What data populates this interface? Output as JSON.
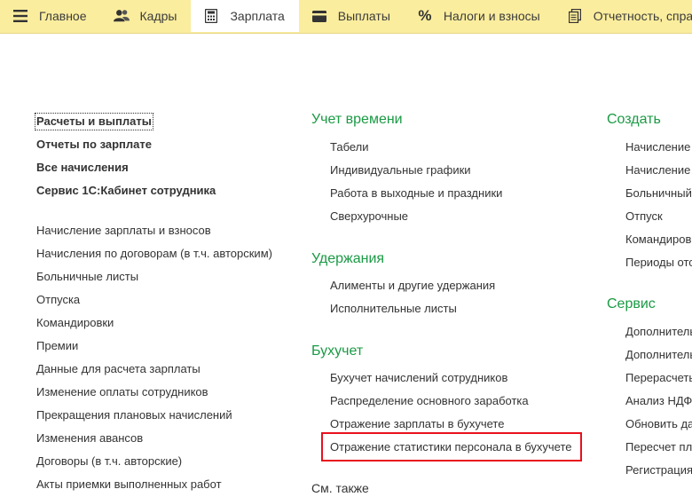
{
  "topbar": {
    "tabs": [
      {
        "label": "Главное",
        "icon": "menu-lines-icon",
        "active": false
      },
      {
        "label": "Кадры",
        "icon": "people-icon",
        "active": false
      },
      {
        "label": "Зарплата",
        "icon": "calculator-icon",
        "active": true
      },
      {
        "label": "Выплаты",
        "icon": "wallet-icon",
        "active": false
      },
      {
        "label": "Налоги и взносы",
        "icon": "percent-icon",
        "active": false
      },
      {
        "label": "Отчетность, справки",
        "icon": "documents-icon",
        "active": false
      }
    ]
  },
  "left_column": {
    "bold_items": [
      "Расчеты и выплаты",
      "Отчеты по зарплате",
      "Все начисления",
      "Сервис 1С:Кабинет сотрудника"
    ],
    "items": [
      "Начисление зарплаты и взносов",
      "Начисления по договорам (в т.ч. авторским)",
      "Больничные листы",
      "Отпуска",
      "Командировки",
      "Премии",
      "Данные для расчета зарплаты",
      "Изменение оплаты сотрудников",
      "Прекращения плановых начислений",
      "Изменения авансов",
      "Договоры (в т.ч. авторские)",
      "Акты приемки выполненных работ"
    ]
  },
  "middle_column": {
    "time": {
      "heading": "Учет времени",
      "items": [
        "Табели",
        "Индивидуальные графики",
        "Работа в выходные и праздники",
        "Сверхурочные"
      ]
    },
    "deductions": {
      "heading": "Удержания",
      "items": [
        "Алименты и другие удержания",
        "Исполнительные листы"
      ]
    },
    "accounting": {
      "heading": "Бухучет",
      "items": [
        "Бухучет начислений сотрудников",
        "Распределение основного заработка",
        "Отражение зарплаты в бухучете",
        "Отражение статистики персонала в бухучете"
      ]
    },
    "see_also": "См. также"
  },
  "right_column": {
    "create": {
      "heading": "Создать",
      "items": [
        "Начисление",
        "Начисление",
        "Больничный",
        "Отпуск",
        "Командиров",
        "Периоды отс"
      ]
    },
    "service": {
      "heading": "Сервис",
      "items": [
        "Дополнитель",
        "Дополнитель",
        "Перерасчеть",
        "Анализ НДФ",
        "Обновить да",
        "Пересчет пл",
        "Регистрация"
      ]
    }
  },
  "colors": {
    "topbar_bg": "#fbed9e",
    "section_heading": "#1a9a44",
    "highlight_border": "#e8101c",
    "text": "#333333"
  }
}
